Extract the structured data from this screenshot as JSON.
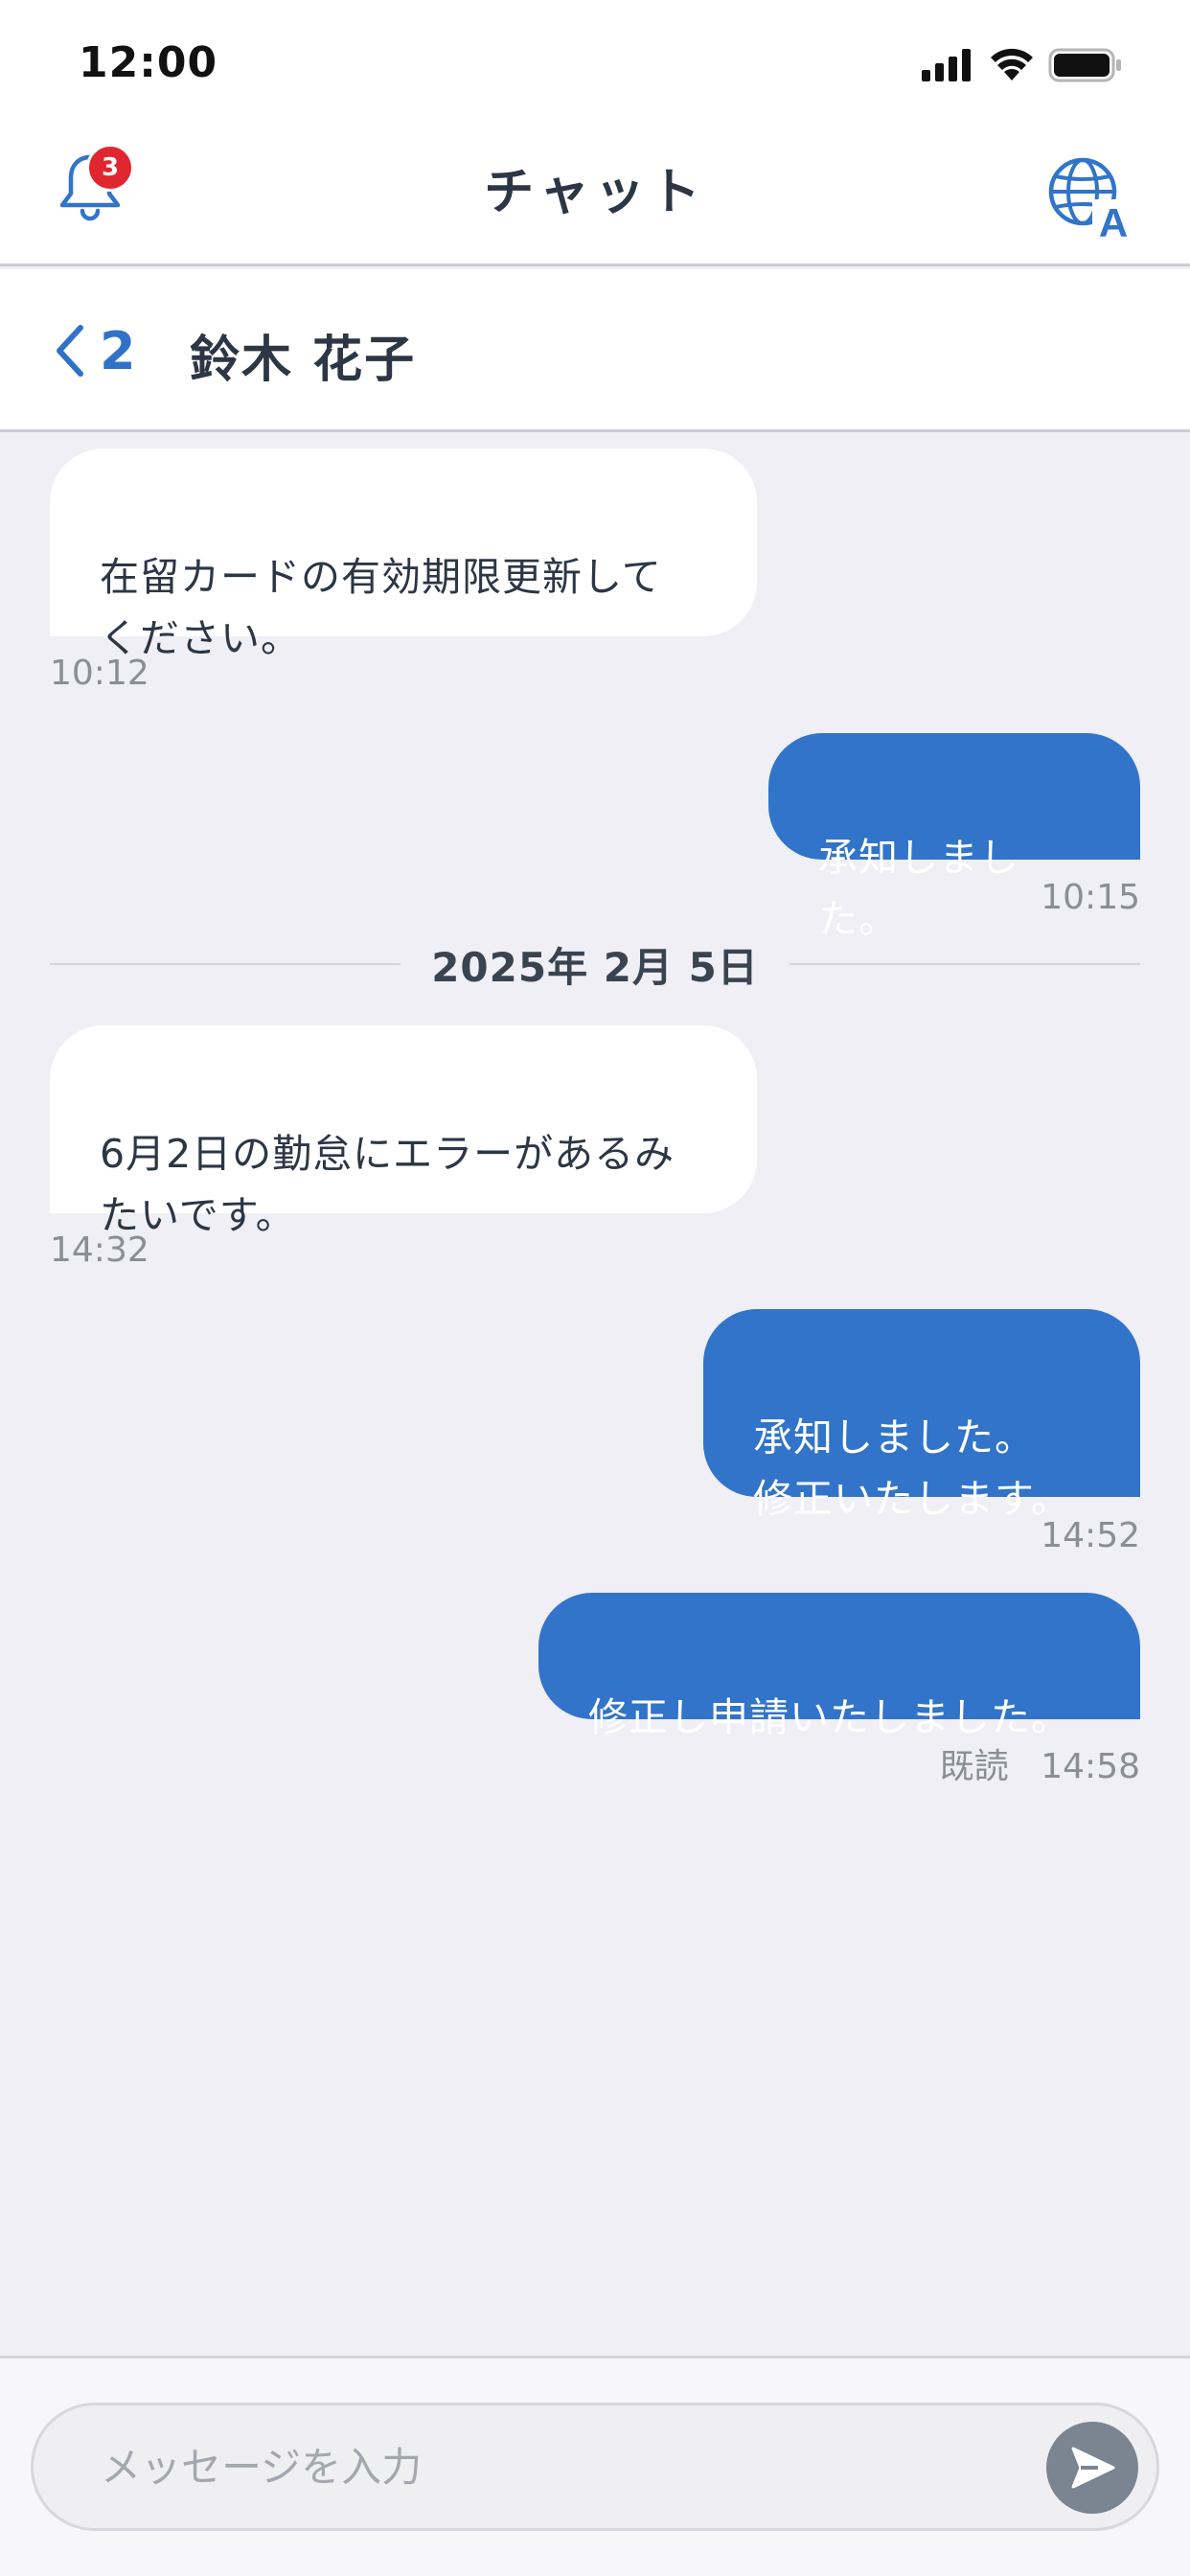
{
  "status_bar": {
    "time": "12:00"
  },
  "header": {
    "title": "チャット",
    "notification_count": "3"
  },
  "conversation": {
    "back_count": "2",
    "contact_name": "鈴木 花子"
  },
  "messages": [
    {
      "direction": "incoming",
      "text": "在留カードの有効期限更新して\nください。",
      "time": "10:12"
    },
    {
      "direction": "outgoing",
      "text": "承知しました。",
      "time": "10:15"
    },
    {
      "direction": "date",
      "text": "2025年 2月 5日"
    },
    {
      "direction": "incoming",
      "text": "6月2日の勤怠にエラーがあるみ\nたいです。",
      "time": "14:32"
    },
    {
      "direction": "outgoing",
      "text": "承知しました。\n修正いたします。",
      "time": "14:52"
    },
    {
      "direction": "outgoing",
      "text": "修正し申請いたしました。",
      "time": "14:58",
      "read_label": "既読"
    }
  ],
  "composer": {
    "placeholder": "メッセージを入力",
    "value": ""
  },
  "icons": {
    "bell": "bell-icon",
    "translate": "globe-translate-icon",
    "back": "chevron-left-icon",
    "send": "send-icon",
    "signal": "signal-icon",
    "wifi": "wifi-icon",
    "battery": "battery-icon"
  },
  "colors": {
    "accent": "#3174c9",
    "badge": "#e0262e",
    "background": "#efeff5",
    "send_button": "#7a8591"
  }
}
